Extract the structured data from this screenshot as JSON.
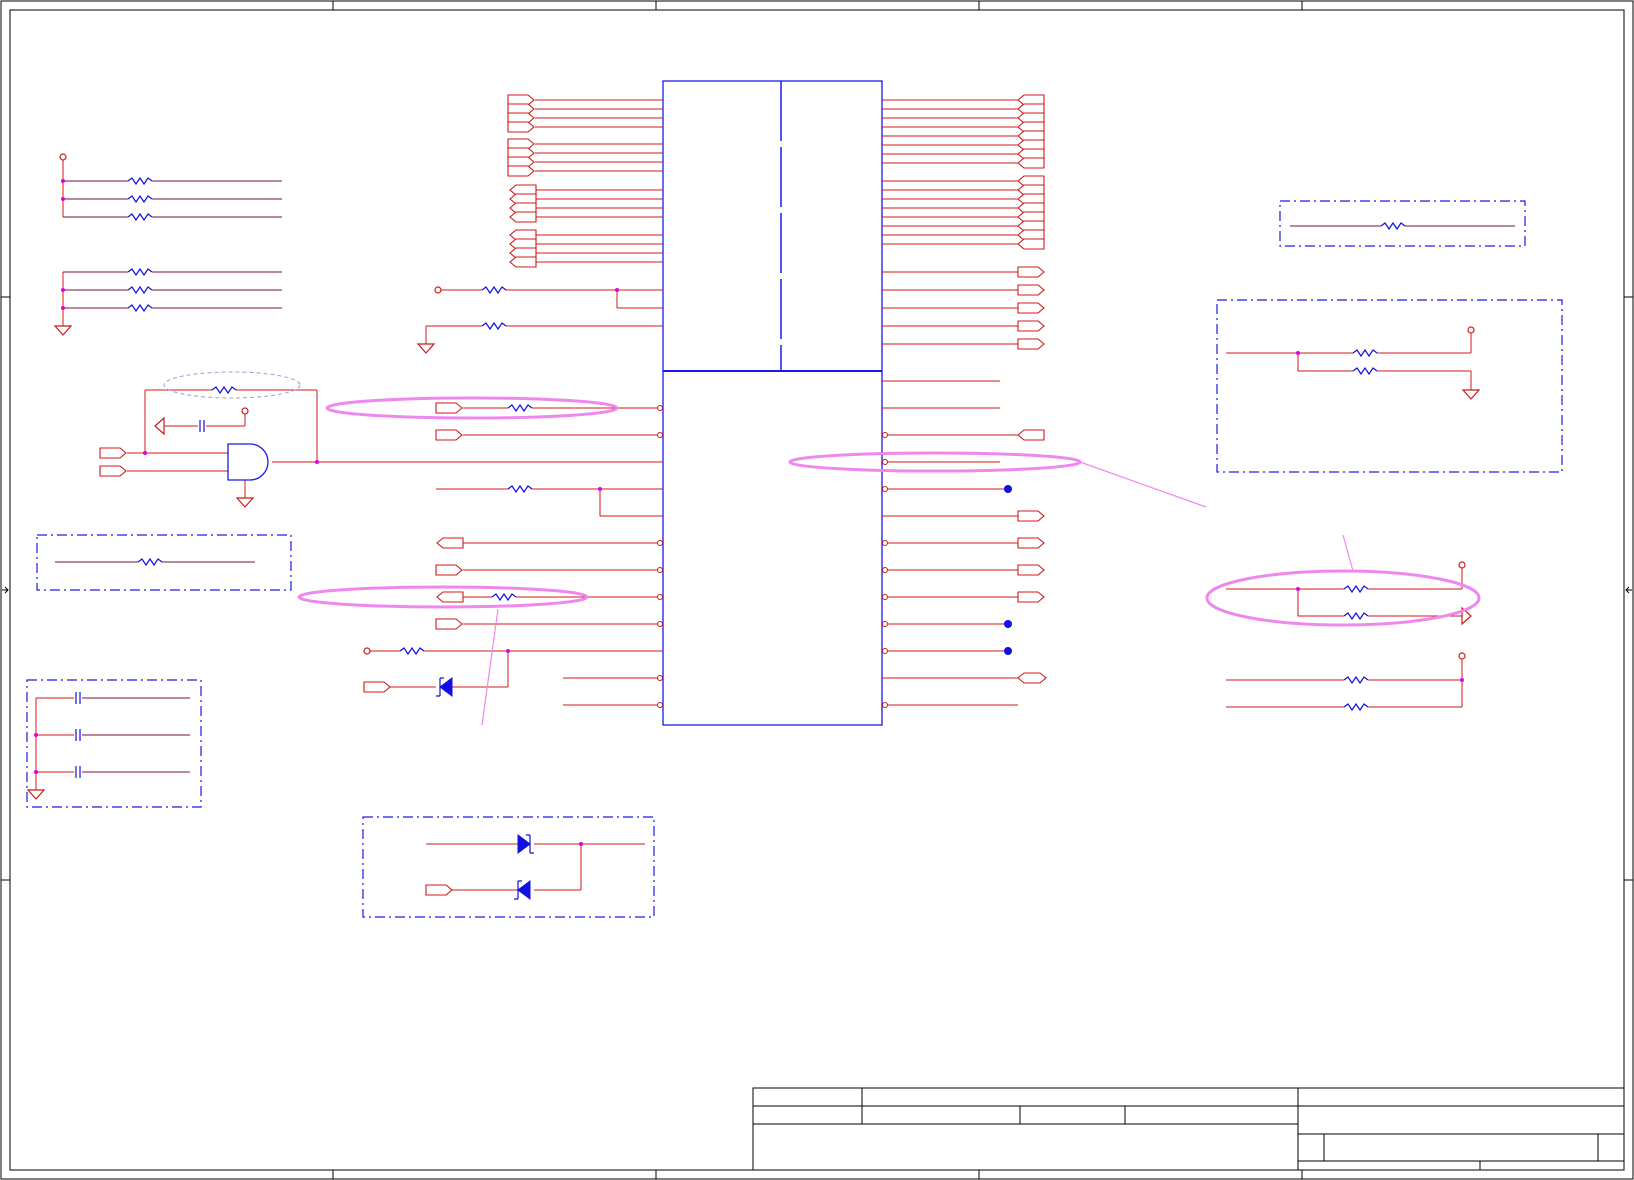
{
  "diagram": {
    "kind": "schematic-sheet",
    "colors": {
      "wire": "#d01818",
      "net": "#7a1040",
      "part": "#1010e0",
      "junction": "#e000e0",
      "highlight": "#ee88ee",
      "frame": "#000000",
      "dashed_box": "#1a1ae8"
    },
    "symbols": [
      "resistor-icon",
      "capacitor-icon",
      "diode-icon",
      "and-gate-icon",
      "ground-icon",
      "power-pin-icon",
      "port-icon"
    ],
    "text": {}
  }
}
